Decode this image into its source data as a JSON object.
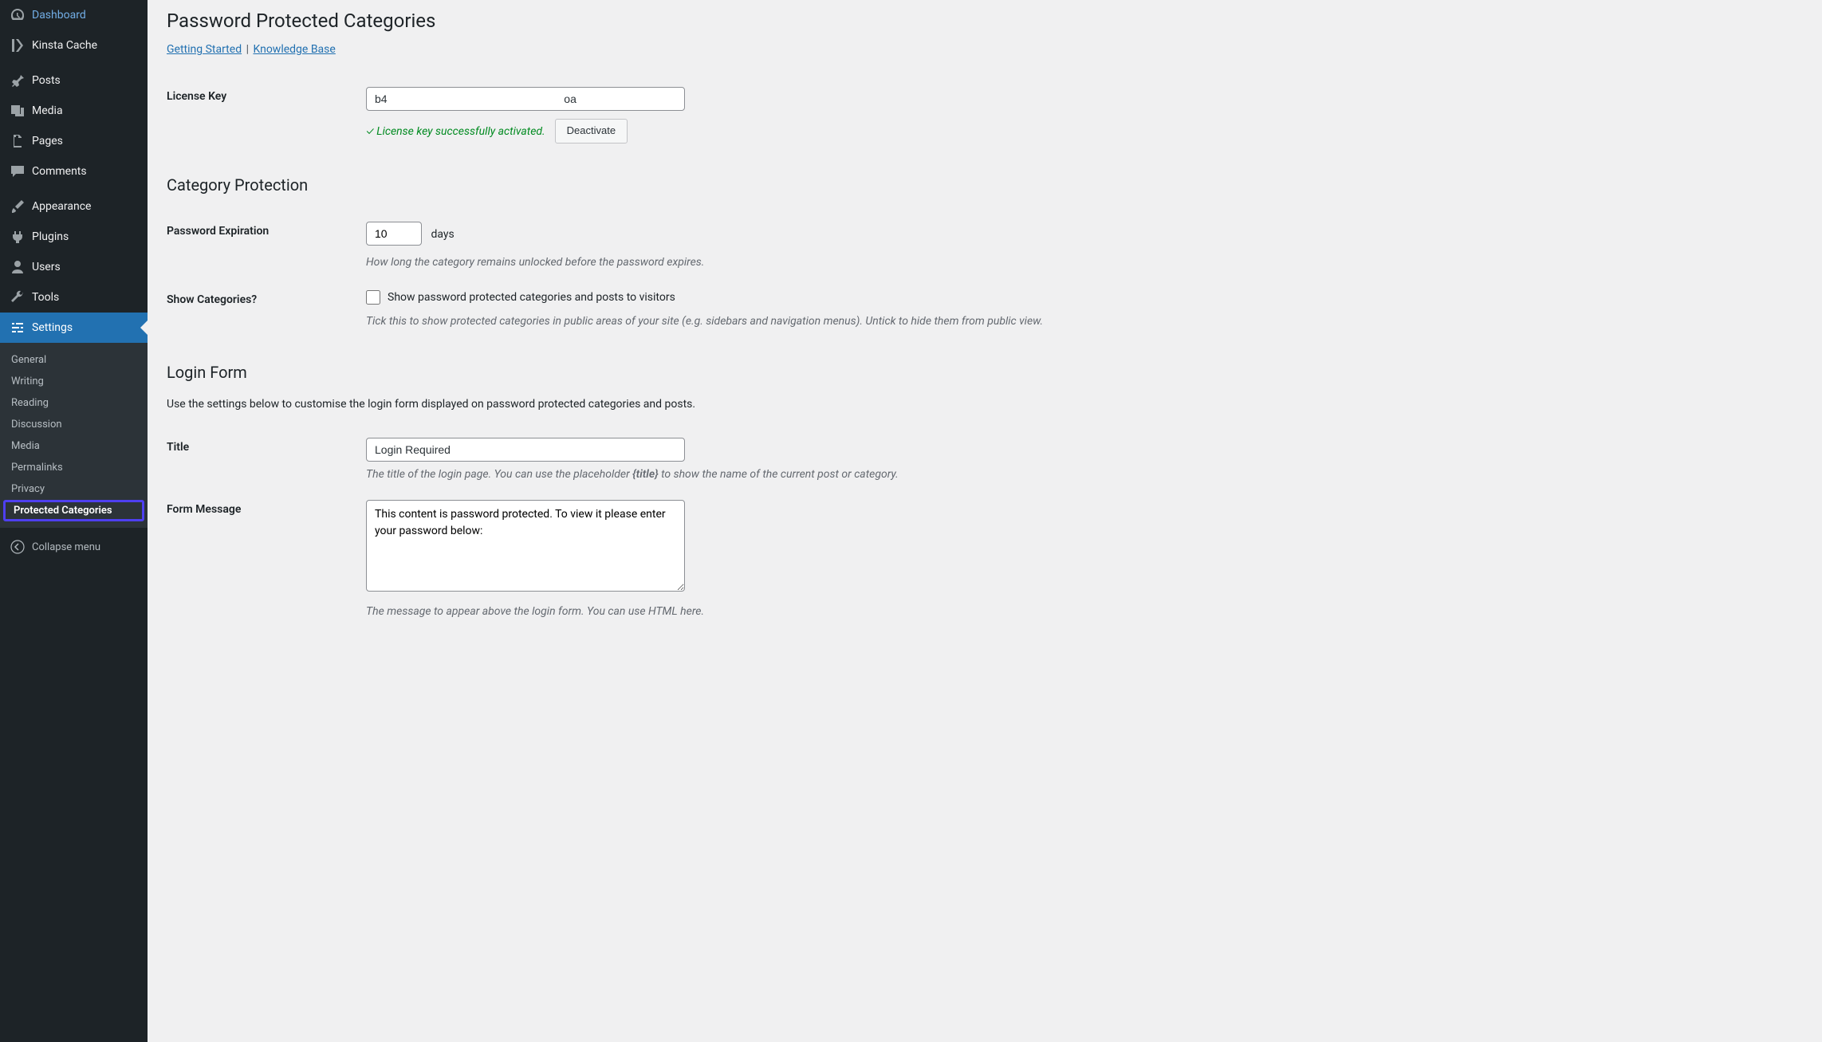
{
  "sidebar": {
    "items": [
      {
        "label": "Dashboard"
      },
      {
        "label": "Kinsta Cache"
      },
      {
        "label": "Posts"
      },
      {
        "label": "Media"
      },
      {
        "label": "Pages"
      },
      {
        "label": "Comments"
      },
      {
        "label": "Appearance"
      },
      {
        "label": "Plugins"
      },
      {
        "label": "Users"
      },
      {
        "label": "Tools"
      },
      {
        "label": "Settings"
      }
    ],
    "submenu": [
      "General",
      "Writing",
      "Reading",
      "Discussion",
      "Media",
      "Permalinks",
      "Privacy",
      "Protected Categories"
    ],
    "collapse": "Collapse menu"
  },
  "page": {
    "title": "Password Protected Categories",
    "links": {
      "getting_started": "Getting Started",
      "knowledge_base": "Knowledge Base"
    }
  },
  "license": {
    "row_label": "License Key",
    "value": "b4                                                         oa",
    "status_msg": "✓ License key successfully activated.",
    "deactivate_btn": "Deactivate"
  },
  "category_protection": {
    "heading": "Category Protection",
    "expiration_label": "Password Expiration",
    "expiration_value": "10",
    "expiration_unit": "days",
    "expiration_help": "How long the category remains unlocked before the password expires.",
    "show_cat_label": "Show Categories?",
    "show_cat_checkbox_label": "Show password protected categories and posts to visitors",
    "show_cat_checked": false,
    "show_cat_help": "Tick this to show protected categories in public areas of your site (e.g. sidebars and navigation menus). Untick to hide them from public view."
  },
  "login_form": {
    "heading": "Login Form",
    "desc": "Use the settings below to customise the login form displayed on password protected categories and posts.",
    "title_label": "Title",
    "title_value": "Login Required",
    "title_help_pre": "The title of the login page. You can use the placeholder ",
    "title_help_ph": "{title}",
    "title_help_post": " to show the name of the current post or category.",
    "msg_label": "Form Message",
    "msg_value": "This content is password protected. To view it please enter your password below:",
    "msg_help": "The message to appear above the login form. You can use HTML here."
  }
}
